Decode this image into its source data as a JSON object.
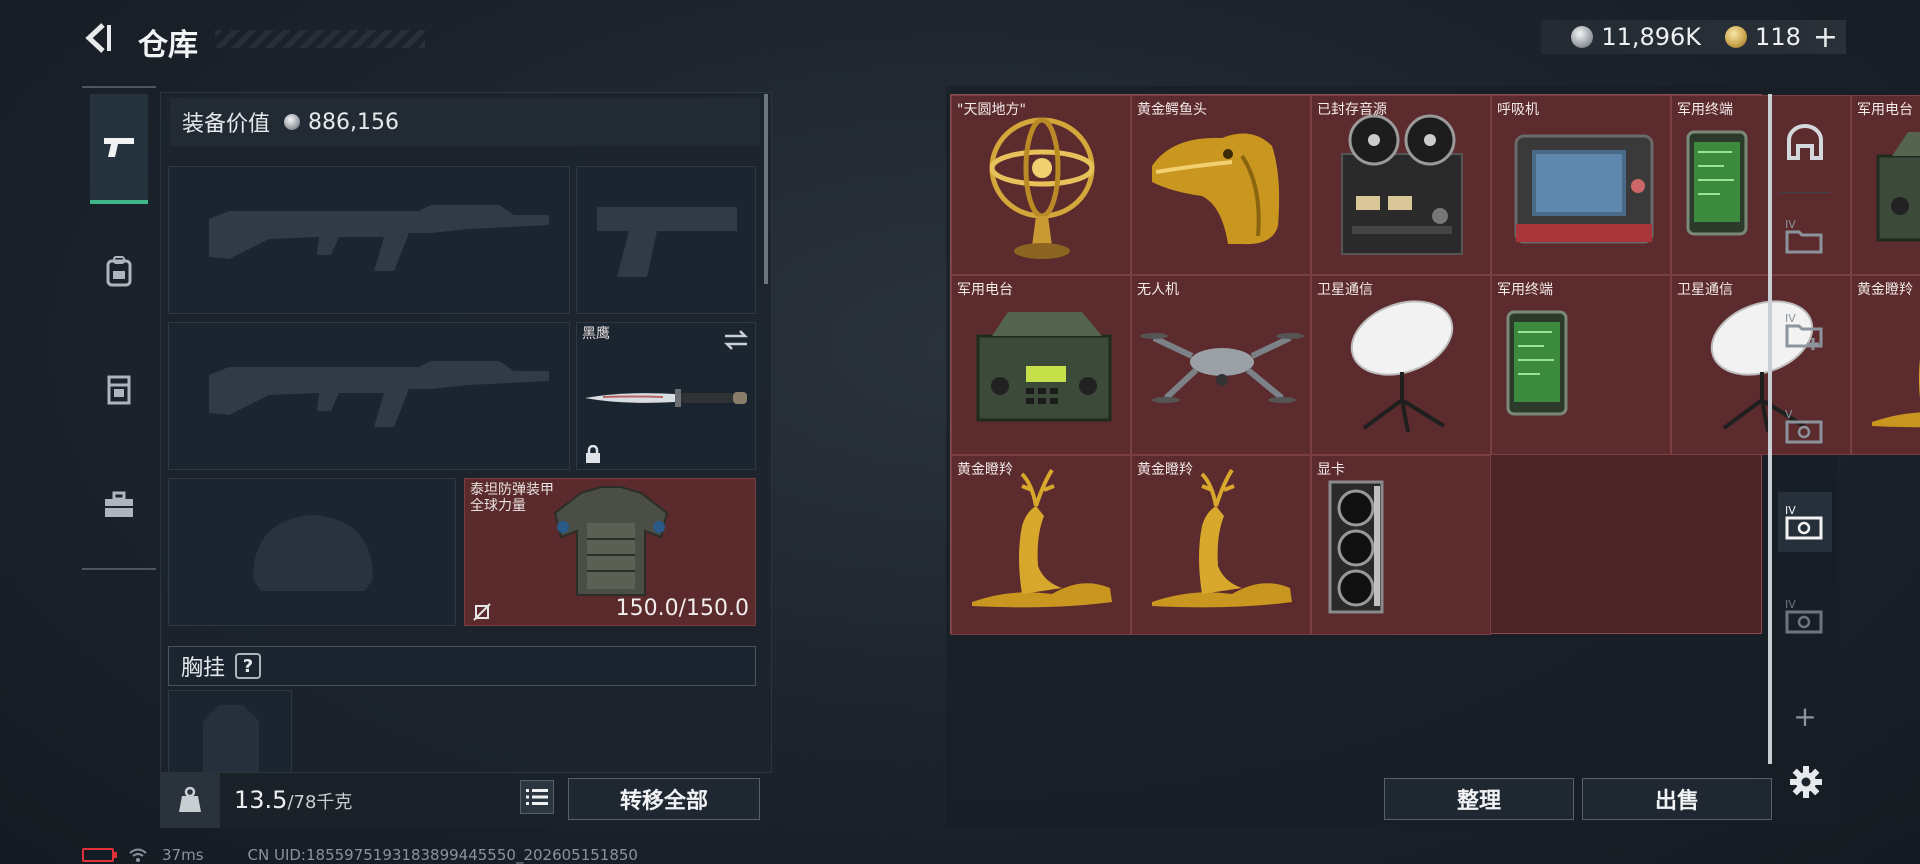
{
  "header": {
    "title": "仓库",
    "currency_silver": "11,896K",
    "currency_gold": "118"
  },
  "loadout": {
    "equip_value_label": "装备价值",
    "equip_value": "886,156",
    "melee": {
      "name": "黑鹰"
    },
    "armor": {
      "name_line1": "泰坦防弹装甲",
      "name_line2": "全球力量",
      "durability": "150.0/150.0"
    },
    "chest_rig_label": "胸挂",
    "help_symbol": "?",
    "weight_value": "13.5",
    "weight_capacity": "/78千克",
    "transfer_all": "转移全部"
  },
  "storage": {
    "items": [
      {
        "name": "\"天圆地方\"",
        "icon": "armillary-sphere-icon"
      },
      {
        "name": "黄金鳄鱼头",
        "icon": "golden-crocodile-head-icon"
      },
      {
        "name": "已封存音源",
        "icon": "reel-to-reel-tape-icon"
      },
      {
        "name": "呼吸机",
        "icon": "ventilator-icon"
      },
      {
        "name": "军用终端",
        "icon": "military-terminal-icon"
      },
      {
        "name": "军用电台",
        "icon": "military-radio-icon"
      },
      {
        "name": "军用电台",
        "icon": "military-radio-icon"
      },
      {
        "name": "无人机",
        "icon": "drone-icon"
      },
      {
        "name": "卫星通信",
        "icon": "satellite-dish-icon"
      },
      {
        "name": "军用终端",
        "icon": "military-terminal-icon"
      },
      {
        "name": "卫星通信",
        "icon": "satellite-dish-icon"
      },
      {
        "name": "黄金瞪羚",
        "icon": "golden-gazelle-icon"
      },
      {
        "name": "黄金瞪羚",
        "icon": "golden-gazelle-icon"
      },
      {
        "name": "黄金瞪羚",
        "icon": "golden-gazelle-icon"
      },
      {
        "name": "显卡",
        "icon": "graphics-card-icon"
      }
    ],
    "sort_label": "整理",
    "sell_label": "出售"
  },
  "right_rail": {
    "tab_labels": [
      "IV",
      "IV",
      "V",
      "IV",
      "IV"
    ],
    "add_symbol": "+"
  },
  "status_bar": {
    "ping": "37ms",
    "uid": "CN UID:1855975193183899445550_202605151850"
  },
  "colors": {
    "accent_green": "#3fb58a",
    "item_bg": "#5c2b2e",
    "item_border": "#7a3f43",
    "battery_red": "#e0303a"
  }
}
